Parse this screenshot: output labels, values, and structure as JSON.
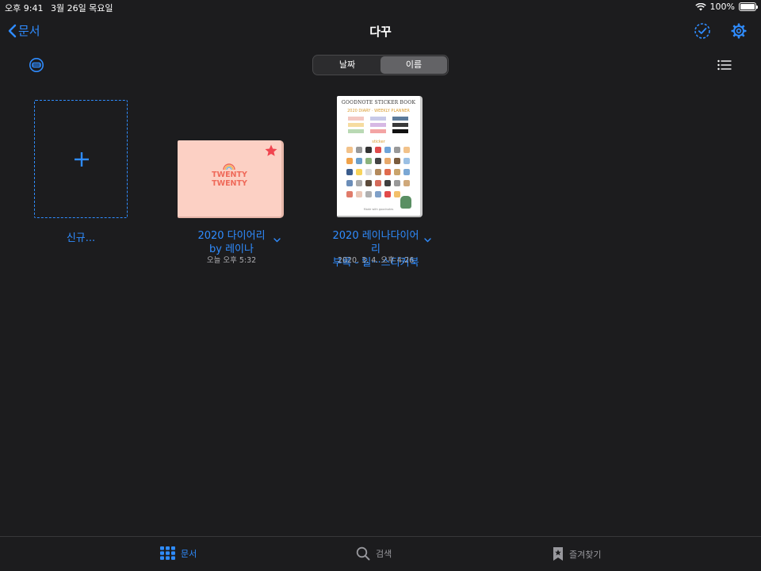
{
  "status_bar": {
    "time": "오후 9:41",
    "date": "3월 26일 목요일",
    "battery": "100%"
  },
  "nav": {
    "back_label": "문서",
    "title": "다꾸"
  },
  "sort": {
    "options": [
      "날짜",
      "이름"
    ],
    "selected": "이름"
  },
  "new_document": {
    "label": "신규..."
  },
  "documents": [
    {
      "title_line1": "2020 다이어리",
      "title_line2": "by 레이나",
      "date": "오늘 오후 5:32",
      "cover_text_line1": "TWENTY",
      "cover_text_line2": "TWENTY",
      "favorite": true
    },
    {
      "title_line1": "2020 레이나다이어리",
      "title_line2": "부록 - 일···스티커북",
      "date": "2020. 3. 4. 오후 4:26",
      "cover_title": "GOODNOTE STICKER BOOK",
      "cover_subtitle": "2020 DIARY · WEEKLY PLANNER",
      "cover_section": "sticker",
      "cover_footer": "Made with goodnotes"
    }
  ],
  "tabs": [
    {
      "label": "문서",
      "active": true
    },
    {
      "label": "검색",
      "active": false
    },
    {
      "label": "즐겨찾기",
      "active": false
    }
  ],
  "colors": {
    "accent": "#2f8cff",
    "background": "#1c1c1e",
    "favorite_star": "#f0444f",
    "pink_cover": "#fcd0c4"
  }
}
